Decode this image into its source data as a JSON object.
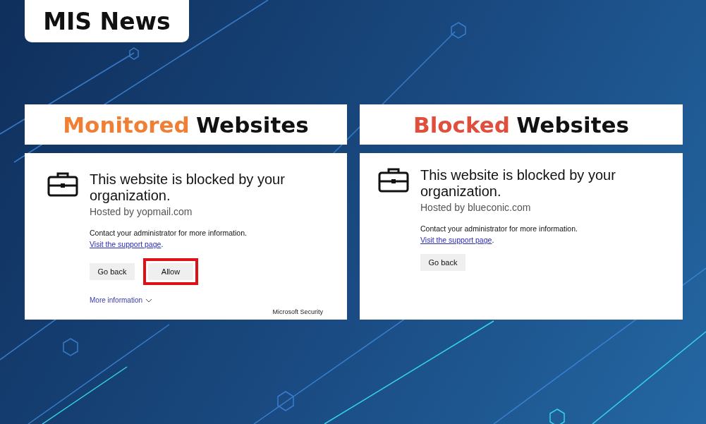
{
  "badge": {
    "title": "MIS News"
  },
  "panels": [
    {
      "heading": {
        "accent": "Monitored",
        "rest": "Websites",
        "color": "#f07f36"
      },
      "card": {
        "title": "This website is blocked by your organization.",
        "hosted": "Hosted by yopmail.com",
        "message": "Contact your administrator for more information.",
        "link": "Visit the support page",
        "after_link": ".",
        "buttons": [
          {
            "label": "Go back",
            "highlighted": false
          },
          {
            "label": "Allow",
            "highlighted": true
          }
        ],
        "more": {
          "label": "More information",
          "expanded": false
        },
        "footer": "Microsoft Security"
      }
    },
    {
      "heading": {
        "accent": "Blocked",
        "rest": "Websites",
        "color": "#e04e3c"
      },
      "card": {
        "title": "This website is blocked by your organization.",
        "hosted": "Hosted by blueconic.com",
        "message": "Contact your administrator for more information.",
        "link": "Visit the support page",
        "after_link": ".",
        "buttons": [
          {
            "label": "Go back",
            "highlighted": false
          }
        ]
      }
    }
  ]
}
